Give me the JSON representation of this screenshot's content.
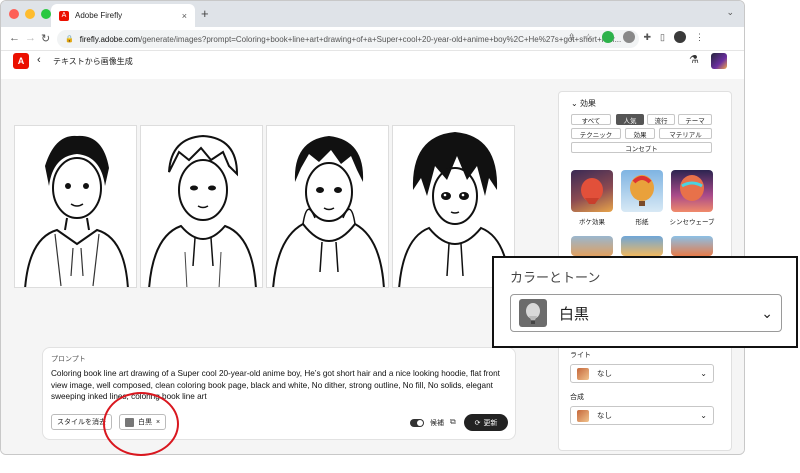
{
  "browser": {
    "tab_title": "Adobe Firefly",
    "tab_close": "×",
    "new_tab": "+",
    "url_host": "firefly.adobe.com",
    "url_path": "/generate/images?prompt=Coloring+book+line+art+drawing+of+a+Super+cool+20-year-old+anime+boy%2C+He%27s+got+short+hair..."
  },
  "app": {
    "logo": "A",
    "title": "テキストから画像生成"
  },
  "prompt": {
    "label": "プロンプト",
    "text": "Coloring book line art drawing of a Super cool 20-year-old anime boy, He’s got short hair and a nice looking hoodie, flat front view image, well composed, clean coloring book page, black and white, No dither, strong outline, No fill, No solids, elegant sweeping inked lines, coloring book line art",
    "clear_style": "スタイルを消去",
    "style_chip": "白黒",
    "candidates": "候補",
    "update": "更新"
  },
  "panel": {
    "effects_header": "効果",
    "filters": [
      "すべて",
      "人気",
      "流行",
      "テーマ",
      "テクニック",
      "効果",
      "マテリアル",
      "コンセプト"
    ],
    "thumbs": [
      "ボケ効果",
      "形紙",
      "シンセウェーブ"
    ],
    "light_label": "ライト",
    "light_value": "なし",
    "composite_label": "合成",
    "composite_value": "なし"
  },
  "callout": {
    "title": "カラーとトーン",
    "value": "白黒"
  },
  "colors": {
    "adobe_red": "#eb1000",
    "annotation_red": "#d9171f"
  }
}
